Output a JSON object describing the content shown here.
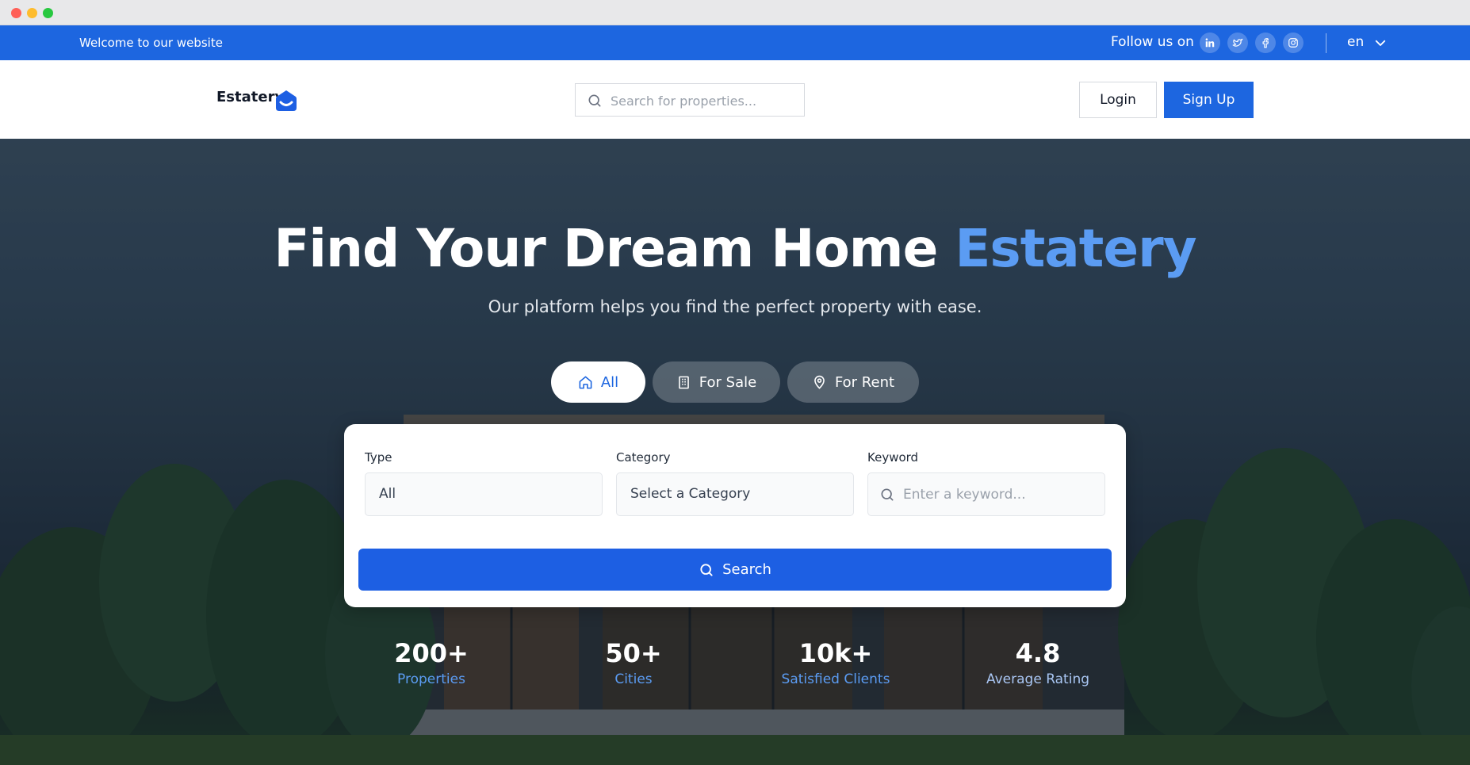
{
  "topbar": {
    "welcome": "Welcome to our website",
    "follow_label": "Follow us on",
    "social_icons": [
      "linkedin-icon",
      "twitter-icon",
      "facebook-icon",
      "instagram-icon"
    ],
    "language": "en"
  },
  "header": {
    "logo_text": "Estatery",
    "search_placeholder": "Search for properties...",
    "login_label": "Login",
    "signup_label": "Sign Up"
  },
  "hero": {
    "title_main": "Find Your Dream Home",
    "title_accent": "Estatery",
    "subtitle": "Our platform helps you find the perfect property with ease.",
    "tabs": [
      {
        "label": "All",
        "icon": "home-icon",
        "active": true
      },
      {
        "label": "For Sale",
        "icon": "building-icon",
        "active": false
      },
      {
        "label": "For Rent",
        "icon": "map-pin-icon",
        "active": false
      }
    ]
  },
  "search_panel": {
    "type_label": "Type",
    "type_value": "All",
    "category_label": "Category",
    "category_value": "Select a Category",
    "keyword_label": "Keyword",
    "keyword_placeholder": "Enter a keyword...",
    "search_button": "Search"
  },
  "stats": [
    {
      "value": "200+",
      "label": "Properties"
    },
    {
      "value": "50+",
      "label": "Cities"
    },
    {
      "value": "10k+",
      "label": "Satisfied Clients"
    },
    {
      "value": "4.8",
      "label": "Average Rating"
    }
  ],
  "colors": {
    "primary": "#1d66e0",
    "accent": "#5b9cf3",
    "white": "#ffffff"
  }
}
